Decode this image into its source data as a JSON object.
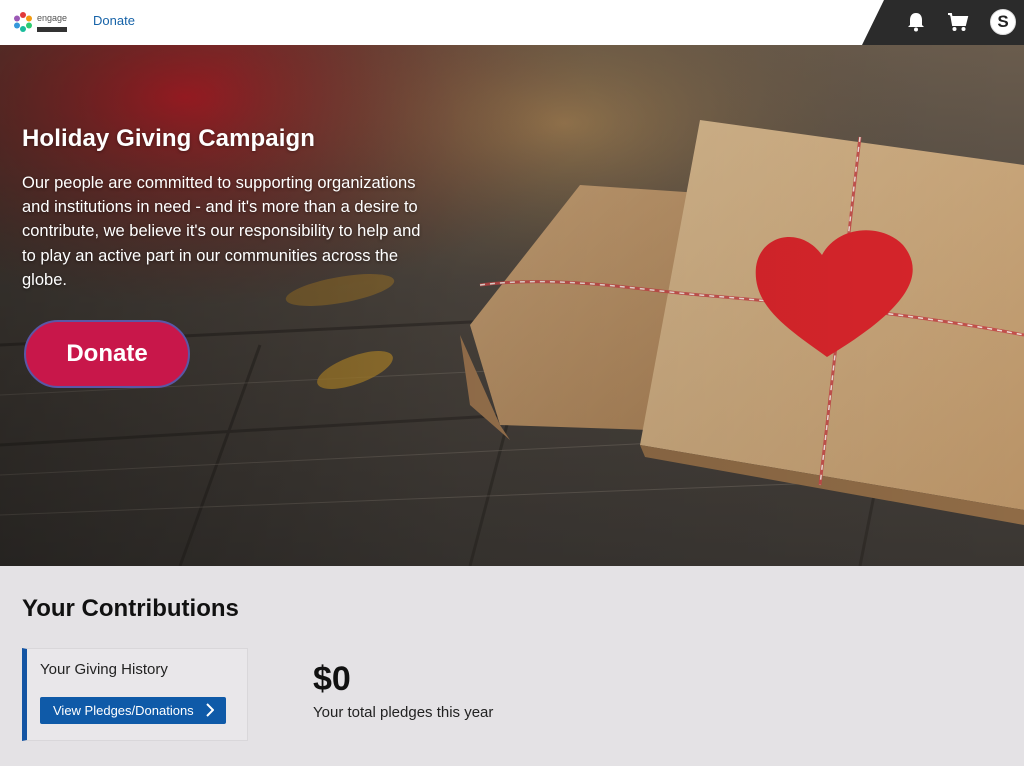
{
  "header": {
    "logo_alt": "engage",
    "nav_donate": "Donate",
    "icons": [
      "bell-icon",
      "cart-icon",
      "user-avatar"
    ],
    "avatar_initial": "S"
  },
  "hero": {
    "title": "Holiday Giving Campaign",
    "description": "Our people are committed to supporting organizations and institutions in need - and it's more than a desire to contribute, we believe it's our responsibility to help and to play an active part in our communities across the globe.",
    "donate_label": "Donate"
  },
  "contributions": {
    "title": "Your Contributions",
    "history_label": "Your Giving History",
    "view_button_label": "View Pledges/Donations",
    "total_amount": "$0",
    "total_label": "Your total pledges this year"
  },
  "colors": {
    "accent_blue": "#0f5aa8",
    "donate_red": "#c8174a",
    "header_dark": "#2b2b2b",
    "page_bg": "#e4e2e5"
  }
}
